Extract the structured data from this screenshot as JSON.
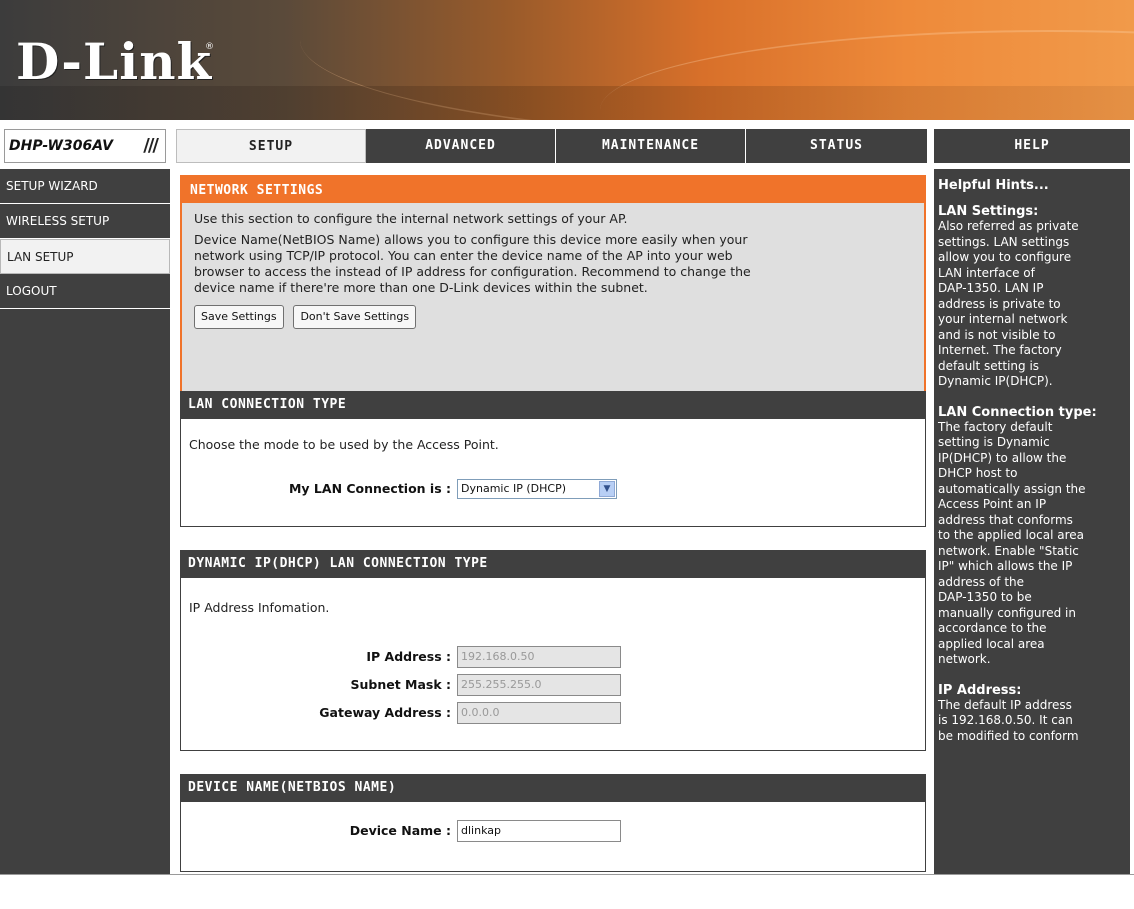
{
  "brand": {
    "logo_text": "D-Link",
    "registered": "®"
  },
  "model": {
    "name": "DHP-W306AV",
    "slashes": "///"
  },
  "tabs": [
    {
      "label": "SETUP",
      "active": true
    },
    {
      "label": "ADVANCED",
      "active": false
    },
    {
      "label": "MAINTENANCE",
      "active": false
    },
    {
      "label": "STATUS",
      "active": false
    },
    {
      "label": "HELP",
      "active": false
    }
  ],
  "sidebar": {
    "items": [
      {
        "label": "SETUP WIZARD",
        "active": false
      },
      {
        "label": "WIRELESS SETUP",
        "active": false
      },
      {
        "label": "LAN SETUP",
        "active": true
      },
      {
        "label": "LOGOUT",
        "active": false
      }
    ]
  },
  "network_settings": {
    "title": "NETWORK SETTINGS",
    "intro": "Use this section to configure the internal network settings of your AP.",
    "description_lines": [
      "Device Name(NetBIOS Name) allows you to configure this device more easily when your",
      "network using TCP/IP protocol. You can enter the device name of the AP into your web",
      "browser to access the instead of IP address for configuration. Recommend to change the",
      "device name if there're more than one D-Link devices within the subnet."
    ],
    "save_button": "Save Settings",
    "dont_save_button": "Don't Save Settings"
  },
  "lan_connection": {
    "title": "LAN CONNECTION TYPE",
    "description": "Choose the mode to be used by the Access Point.",
    "label": "My LAN Connection is :",
    "selected": "Dynamic IP (DHCP)"
  },
  "dhcp": {
    "title": "DYNAMIC IP(DHCP) LAN CONNECTION TYPE",
    "info": "IP Address Infomation.",
    "ip_label": "IP Address :",
    "ip_value": "192.168.0.50",
    "mask_label": "Subnet Mask :",
    "mask_value": "255.255.255.0",
    "gateway_label": "Gateway Address :",
    "gateway_value": "0.0.0.0"
  },
  "device_name": {
    "title": "DEVICE NAME(NETBIOS NAME)",
    "label": "Device Name :",
    "value": "dlinkap"
  },
  "help": {
    "title": "Helpful Hints...",
    "sections": [
      {
        "heading": "LAN Settings:",
        "lines": [
          "Also referred as private",
          "settings. LAN settings",
          "allow you to configure",
          "LAN interface of",
          "DAP-1350. LAN IP",
          "address is private to",
          "your internal network",
          "and is not visible to",
          "Internet. The factory",
          "default setting is",
          "Dynamic IP(DHCP)."
        ]
      },
      {
        "heading": "LAN Connection type:",
        "lines": [
          "The factory default",
          "setting is Dynamic",
          "IP(DHCP) to allow the",
          "DHCP host to",
          "automatically assign the",
          "Access Point an IP",
          "address that conforms",
          "to the applied local area",
          "network. Enable \"Static",
          "IP\" which allows the IP",
          "address of the",
          "DAP-1350 to be",
          "manually configured in",
          "accordance to the",
          "applied local area",
          "network."
        ]
      },
      {
        "heading": "IP Address:",
        "lines": [
          "The default IP address",
          "is 192.168.0.50. It can",
          "be modified to conform"
        ]
      }
    ]
  }
}
